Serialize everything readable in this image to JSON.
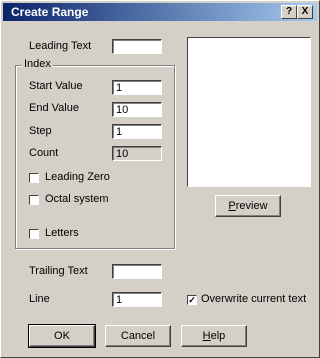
{
  "window": {
    "title": "Create Range",
    "help_glyph": "?",
    "close_glyph": "X"
  },
  "form": {
    "leading_text": {
      "label": "Leading Text",
      "value": ""
    },
    "index_group": {
      "title": "Index",
      "start_value": {
        "label": "Start Value",
        "value": "1"
      },
      "end_value": {
        "label": "End Value",
        "value": "10"
      },
      "step": {
        "label": "Step",
        "value": "1"
      },
      "count": {
        "label": "Count",
        "value": "10"
      },
      "leading_zero": {
        "label": "Leading Zero",
        "checked": false
      },
      "octal_system": {
        "label": "Octal system",
        "checked": false
      },
      "letters": {
        "label": "Letters",
        "checked": false
      }
    },
    "trailing_text": {
      "label": "Trailing Text",
      "value": ""
    },
    "line": {
      "label": "Line",
      "value": "1"
    },
    "overwrite": {
      "label": "Overwrite current text",
      "checked": true,
      "mark": "✓"
    }
  },
  "buttons": {
    "preview_first": "P",
    "preview_rest": "review",
    "ok": "OK",
    "cancel": "Cancel",
    "help_first": "H",
    "help_rest": "elp"
  }
}
